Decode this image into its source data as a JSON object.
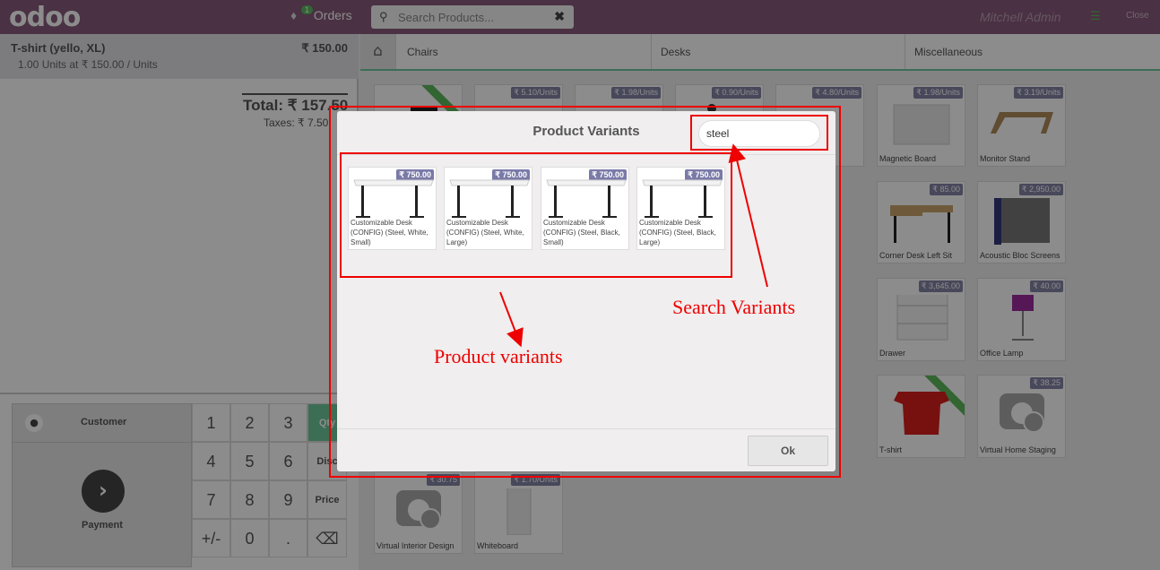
{
  "topbar": {
    "logo": "odoo",
    "orders_label": "Orders",
    "orders_count": "1",
    "search_placeholder": "Search Products...",
    "user": "Mitchell Admin",
    "close_label": "Close"
  },
  "order": {
    "line_name": "T-shirt (yello, XL)",
    "line_price": "₹ 150.00",
    "line_info": "1.00 Units at ₹ 150.00 / Units",
    "total": "Total: ₹ 157.50",
    "taxes": "Taxes: ₹ 7.50"
  },
  "pad": {
    "customer": "Customer",
    "payment": "Payment",
    "keys": [
      "1",
      "2",
      "3",
      "4",
      "5",
      "6",
      "7",
      "8",
      "9",
      "+/-",
      "0",
      "."
    ],
    "modes": [
      "Qty",
      "Disc",
      "Price"
    ],
    "backspace": "⌫"
  },
  "categories": [
    "Chairs",
    "Desks",
    "Miscellaneous"
  ],
  "products": [
    {
      "price": "₹ 5.10/Units",
      "name": ""
    },
    {
      "price": "₹ 1.98/Units",
      "name": ""
    },
    {
      "price": "₹ 0.90/Units",
      "name": ""
    },
    {
      "price": "₹ 4.80/Units",
      "name": ""
    },
    {
      "price": "₹ 1.98/Units",
      "name": "Magnetic Board"
    },
    {
      "price": "₹ 3.19/Units",
      "name": "Monitor Stand"
    },
    {
      "price": "₹ 85.00",
      "name": "Corner Desk Left Sit"
    },
    {
      "price": "₹ 2,950.00",
      "name": "Acoustic Bloc Screens"
    },
    {
      "price": "₹ 3,645.00",
      "name": "Drawer"
    },
    {
      "price": "₹ 40.00",
      "name": "Office Lamp"
    },
    {
      "price": "",
      "name": "T-shirt"
    },
    {
      "price": "₹ 38.25",
      "name": "Virtual Home Staging"
    },
    {
      "price": "₹ 30.75",
      "name": "Virtual Interior Design"
    },
    {
      "price": "₹ 1.70/Units",
      "name": "Whiteboard"
    }
  ],
  "modal": {
    "title": "Product Variants",
    "search_value": "steel",
    "ok": "Ok",
    "variants": [
      {
        "price": "₹ 750.00",
        "name": "Customizable Desk (CONFIG) (Steel, White, Small)"
      },
      {
        "price": "₹ 750.00",
        "name": "Customizable Desk (CONFIG) (Steel, White, Large)"
      },
      {
        "price": "₹ 750.00",
        "name": "Customizable Desk (CONFIG) (Steel, Black, Small)"
      },
      {
        "price": "₹ 750.00",
        "name": "Customizable Desk (CONFIG) (Steel, Black, Large)"
      }
    ]
  },
  "annotations": {
    "search_variants": "Search Variants",
    "product_variants": "Product variants"
  },
  "colors": {
    "brand": "#875a7b",
    "accent": "#6ec89b",
    "annotation": "#ee0000"
  }
}
